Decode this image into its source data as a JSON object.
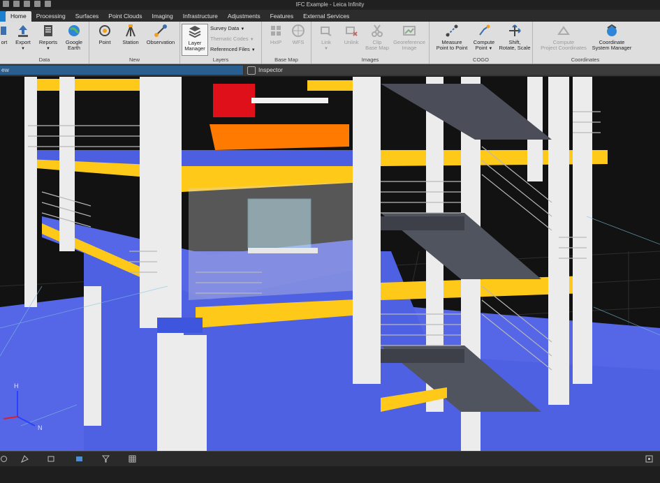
{
  "window": {
    "title": "IFC Example - Leica Infinity"
  },
  "tabs": [
    {
      "label": "Home",
      "active": true
    },
    {
      "label": "Processing"
    },
    {
      "label": "Surfaces"
    },
    {
      "label": "Point Clouds"
    },
    {
      "label": "Imaging"
    },
    {
      "label": "Infrastructure"
    },
    {
      "label": "Adjustments"
    },
    {
      "label": "Features"
    },
    {
      "label": "External Services"
    }
  ],
  "ribbon": {
    "data": {
      "label": "Data",
      "import": "ort",
      "export": "Export",
      "reports": "Reports",
      "google_earth_1": "Google",
      "google_earth_2": "Earth"
    },
    "new": {
      "label": "New",
      "point": "Point",
      "station": "Station",
      "observation": "Observation"
    },
    "layers": {
      "label": "Layers",
      "layer_manager_1": "Layer",
      "layer_manager_2": "Manager",
      "survey_data": "Survey Data",
      "thematic_codes": "Thematic Codes",
      "referenced_files": "Referenced Files"
    },
    "base_map": {
      "label": "Base Map",
      "hxip": "HxIP",
      "wfs": "WFS"
    },
    "images": {
      "label": "Images",
      "link": "Link",
      "unlink": "Unlink",
      "clip_1": "Clip",
      "clip_2": "Base Map",
      "georef_1": "Georeference",
      "georef_2": "Image"
    },
    "cogo": {
      "label": "COGO",
      "measure_1": "Measure",
      "measure_2": "Point to Point",
      "compute_1": "Compute",
      "compute_2": "Point",
      "shift_1": "Shift,",
      "shift_2": "Rotate, Scale"
    },
    "coordinates": {
      "label": "Coordinates",
      "cpc_1": "Compute",
      "cpc_2": "Project Coordinates",
      "csm_1": "Coordinate",
      "csm_2": "System Manager"
    }
  },
  "panels": {
    "left_tab": "ew",
    "inspector": "Inspector"
  },
  "axis": {
    "h": "H",
    "n": "N"
  },
  "colors": {
    "accent": "#1c7fd0",
    "floor_blue": "#5566e6",
    "beam_yellow": "#ffc91a",
    "orange": "#ff7a00",
    "red": "#e0101a"
  }
}
